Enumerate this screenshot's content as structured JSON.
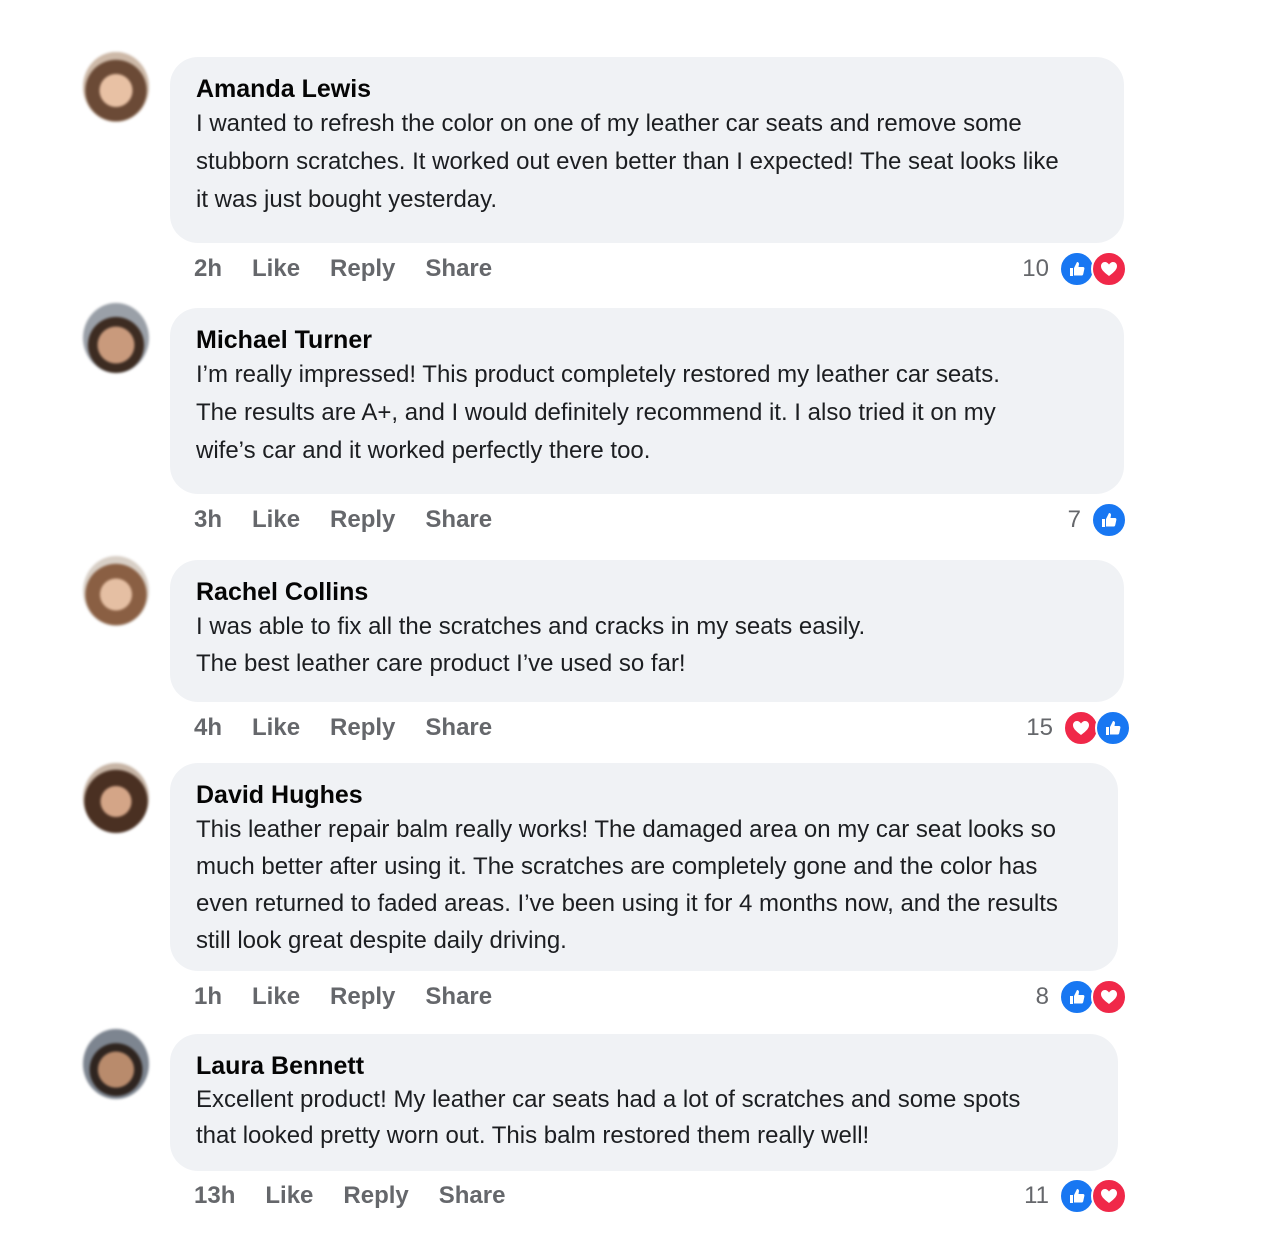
{
  "comments": [
    {
      "author": "Amanda Lewis",
      "lines": [
        "I wanted to refresh the color on one of my leather car seats and remove some",
        "stubborn scratches. It worked out even better than I expected! The seat looks like",
        "it was just bought yesterday."
      ],
      "time": "2h",
      "like_label": "Like",
      "reply_label": "Reply",
      "share_label": "Share",
      "reaction_count": "10",
      "reactions": [
        "like-icon",
        "love-icon"
      ]
    },
    {
      "author": "Michael Turner",
      "lines": [
        "I’m really impressed! This product completely restored my leather car seats.",
        "The results are A+, and I would definitely recommend it. I also tried it on my",
        "wife’s car and it worked perfectly there too."
      ],
      "time": "3h",
      "like_label": "Like",
      "reply_label": "Reply",
      "share_label": "Share",
      "reaction_count": "7",
      "reactions": [
        "like-icon"
      ]
    },
    {
      "author": "Rachel Collins",
      "lines": [
        "I was able to fix all the scratches and cracks in my seats easily.",
        "The best leather care product I’ve used so far!"
      ],
      "time": "4h",
      "like_label": "Like",
      "reply_label": "Reply",
      "share_label": "Share",
      "reaction_count": "15",
      "reactions": [
        "love-icon",
        "like-icon"
      ]
    },
    {
      "author": "David Hughes",
      "lines": [
        "This leather repair balm really works! The damaged area on my car seat looks so",
        "much better after using it. The scratches are completely gone and the color has",
        "even returned to faded areas. I’ve been using it for 4 months now, and the results",
        "still look great despite daily driving."
      ],
      "time": "1h",
      "like_label": "Like",
      "reply_label": "Reply",
      "share_label": "Share",
      "reaction_count": "8",
      "reactions": [
        "like-icon",
        "love-icon"
      ]
    },
    {
      "author": "Laura Bennett",
      "lines": [
        "Excellent product! My leather car seats had a lot of scratches and some spots",
        "that looked pretty worn out. This balm restored them really well!"
      ],
      "time": "13h",
      "like_label": "Like",
      "reply_label": "Reply",
      "share_label": "Share",
      "reaction_count": "11",
      "reactions": [
        "like-icon",
        "love-icon"
      ]
    }
  ],
  "colors": {
    "like": "#1877f2",
    "love": "#f02849",
    "bubble": "#f0f2f5",
    "meta": "#65676b"
  }
}
